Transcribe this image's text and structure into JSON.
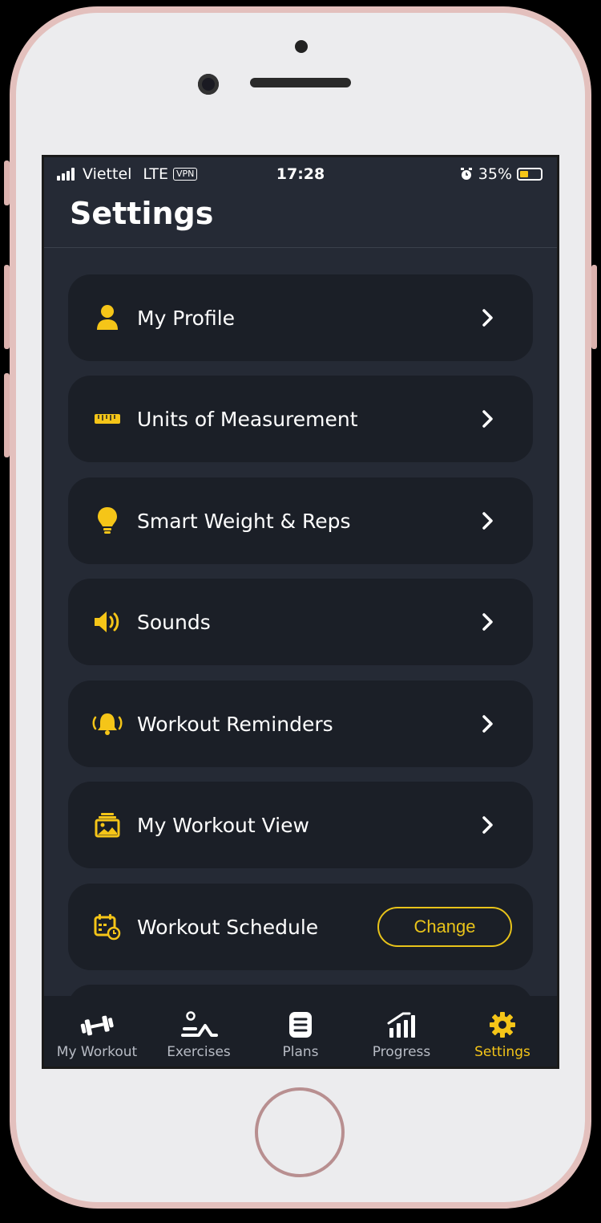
{
  "status_bar": {
    "carrier": "Viettel",
    "network": "LTE",
    "vpn": "VPN",
    "time": "17:28",
    "battery": "35%"
  },
  "header": {
    "title": "Settings"
  },
  "settings": [
    {
      "label": "My Profile",
      "icon": "person-icon"
    },
    {
      "label": "Units of Measurement",
      "icon": "ruler-icon"
    },
    {
      "label": "Smart Weight & Reps",
      "icon": "lightbulb-icon"
    },
    {
      "label": "Sounds",
      "icon": "speaker-icon"
    },
    {
      "label": "Workout Reminders",
      "icon": "bell-icon"
    },
    {
      "label": "My Workout View",
      "icon": "image-icon"
    },
    {
      "label": "Workout Schedule",
      "icon": "calendar-clock-icon",
      "action": "Change"
    }
  ],
  "tabs": [
    {
      "label": "My Workout",
      "icon": "dumbbell-icon"
    },
    {
      "label": "Exercises",
      "icon": "exercise-icon"
    },
    {
      "label": "Plans",
      "icon": "document-icon"
    },
    {
      "label": "Progress",
      "icon": "chart-icon"
    },
    {
      "label": "Settings",
      "icon": "gear-icon",
      "active": true
    }
  ],
  "colors": {
    "accent": "#f5c518",
    "background": "#252a35",
    "card": "#1b1f27"
  }
}
